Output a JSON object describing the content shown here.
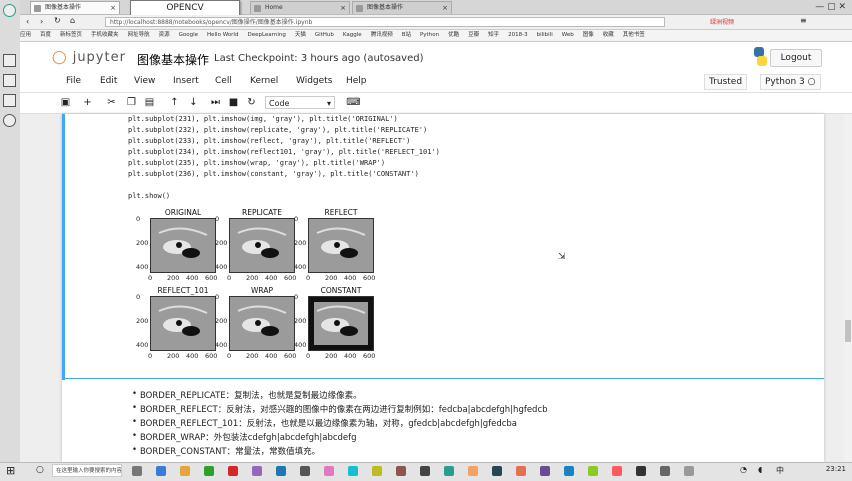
{
  "browser": {
    "tabs": [
      {
        "label": "图像基本操作"
      },
      {
        "label": "Home"
      },
      {
        "label": "图像基本操作"
      }
    ],
    "popup_label": "OPENCV",
    "url": "http://localhost:8888/notebooks/opencv/图像操作/图像基本操作.ipynb",
    "top_right_link": "绿洲视频",
    "bookmarks": [
      "应用",
      "百度",
      "新标签页",
      "手机收藏夹",
      "网址导航",
      "资源",
      "Google",
      "Hello World",
      "DeepLearning",
      "天猫",
      "GitHub",
      "Kaggle",
      "腾讯视频",
      "B站",
      "Python",
      "优酷",
      "豆瓣",
      "知乎",
      "2018-3",
      "bilibili",
      "Web",
      "图像",
      "收藏",
      "其他书签"
    ]
  },
  "jupyter": {
    "logo_text": "jupyter",
    "notebook_title": "图像基本操作",
    "checkpoint": "Last Checkpoint: 3 hours ago (autosaved)",
    "logout_label": "Logout",
    "trusted_label": "Trusted",
    "kernel_label": "Python 3",
    "menus": [
      "File",
      "Edit",
      "View",
      "Insert",
      "Cell",
      "Kernel",
      "Widgets",
      "Help"
    ],
    "cell_type": "Code"
  },
  "code_lines": [
    "plt.subplot(231), plt.imshow(img, 'gray'), plt.title('ORIGINAL')",
    "plt.subplot(232), plt.imshow(replicate, 'gray'), plt.title('REPLICATE')",
    "plt.subplot(233), plt.imshow(reflect, 'gray'), plt.title('REFLECT')",
    "plt.subplot(234), plt.imshow(reflect101, 'gray'), plt.title('REFLECT_101')",
    "plt.subplot(235), plt.imshow(wrap, 'gray'), plt.title('WRAP')",
    "plt.subplot(236), plt.imshow(constant, 'gray'), plt.title('CONSTANT')",
    "",
    "plt.show()"
  ],
  "plots": [
    {
      "title": "ORIGINAL",
      "yticks": [
        "0",
        "200",
        "400"
      ],
      "xticks": [
        "0",
        "200",
        "400",
        "600"
      ]
    },
    {
      "title": "REPLICATE",
      "yticks": [
        "0",
        "200",
        "400"
      ],
      "xticks": [
        "0",
        "200",
        "400",
        "600"
      ]
    },
    {
      "title": "REFLECT",
      "yticks": [
        "0",
        "200",
        "400"
      ],
      "xticks": [
        "0",
        "200",
        "400",
        "600"
      ]
    },
    {
      "title": "REFLECT_101",
      "yticks": [
        "0",
        "200",
        "400"
      ],
      "xticks": [
        "0",
        "200",
        "400",
        "600"
      ]
    },
    {
      "title": "WRAP",
      "yticks": [
        "0",
        "200",
        "400"
      ],
      "xticks": [
        "0",
        "200",
        "400",
        "600"
      ]
    },
    {
      "title": "CONSTANT",
      "yticks": [
        "0",
        "200",
        "400"
      ],
      "xticks": [
        "0",
        "200",
        "400",
        "600"
      ]
    }
  ],
  "markdown": [
    "BORDER_REPLICATE：复制法，也就是复制最边缘像素。",
    "BORDER_REFLECT：反射法，对感兴趣的图像中的像素在两边进行复制例如：fedcba|abcdefgh|hgfedcb",
    "BORDER_REFLECT_101：反射法，也就是以最边缘像素为轴，对称，gfedcb|abcdefgh|gfedcba",
    "BORDER_WRAP：外包装法cdefgh|abcdefgh|abcdefg",
    "BORDER_CONSTANT：常量法，常数值填充。"
  ],
  "taskbar": {
    "search_placeholder": "在这里输入你要搜索的内容",
    "time": "23:21"
  }
}
